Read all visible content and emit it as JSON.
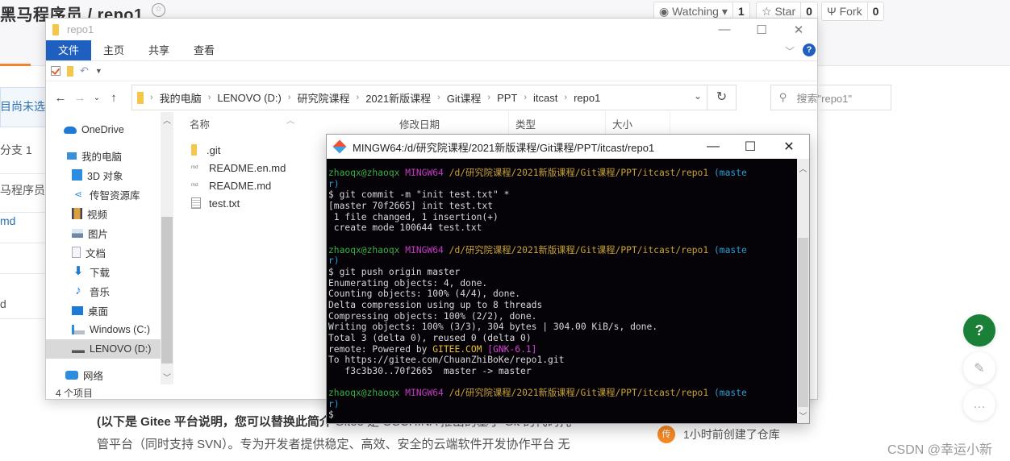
{
  "gitee": {
    "repo_title": "黑马程序员 / repo1",
    "watching": {
      "label": "Watching ▾",
      "count": "1"
    },
    "star": {
      "label": "☆ Star",
      "count": "0"
    },
    "fork": {
      "label": "Fork",
      "count": "0"
    },
    "left_strip": [
      "目尚未选择",
      "分支 1",
      "马程序员",
      "md",
      "",
      "d"
    ],
    "readme_line1_bold": "(以下是 Gitee 平台说明，您可以替换此简介",
    "readme_line1_rest": " Gitee 是 OSCHINA 推出的基于 Git 的代码托",
    "readme_line2": "管平台（同时支持 SVN）。专为开发者提供稳定、高效、安全的云端软件开发协作平台 无",
    "activity_avatar": "传",
    "activity_text": "1小时前创建了仓库",
    "help_button": "?",
    "watermark": "CSDN @幸运小新",
    "colors": {
      "accent_orange": "#f08530",
      "help_green": "#1a7f37"
    }
  },
  "explorer": {
    "title": "repo1",
    "ribbon_tabs": [
      "文件",
      "主页",
      "共享",
      "查看"
    ],
    "breadcrumbs": [
      "我的电脑",
      "LENOVO (D:)",
      "研究院课程",
      "2021新版课程",
      "Git课程",
      "PPT",
      "itcast",
      "repo1"
    ],
    "search_placeholder": "搜索\"repo1\"",
    "nav_items": [
      {
        "label": "OneDrive",
        "icon": "onedrive-icon"
      },
      {
        "label": "我的电脑",
        "icon": "computer-icon"
      },
      {
        "label": "3D 对象",
        "icon": "3d-objects-icon"
      },
      {
        "label": "传智资源库",
        "icon": "share-library-icon"
      },
      {
        "label": "视频",
        "icon": "video-icon"
      },
      {
        "label": "图片",
        "icon": "pictures-icon"
      },
      {
        "label": "文档",
        "icon": "documents-icon"
      },
      {
        "label": "下载",
        "icon": "download-icon"
      },
      {
        "label": "音乐",
        "icon": "music-icon"
      },
      {
        "label": "桌面",
        "icon": "desktop-icon"
      },
      {
        "label": "Windows (C:)",
        "icon": "drive-c-icon"
      },
      {
        "label": "LENOVO (D:)",
        "icon": "drive-d-icon",
        "selected": true
      },
      {
        "label": "网络",
        "icon": "network-icon"
      }
    ],
    "columns": [
      "名称",
      "修改日期",
      "类型",
      "大小"
    ],
    "files": [
      {
        "name": ".git",
        "icon": "folder-icon"
      },
      {
        "name": "README.en.md",
        "icon": "markdown-file-icon"
      },
      {
        "name": "README.md",
        "icon": "markdown-file-icon"
      },
      {
        "name": "test.txt",
        "icon": "text-file-icon"
      }
    ],
    "status": "4 个项目"
  },
  "terminal": {
    "title": "MINGW64:/d/研究院课程/2021新版课程/Git课程/PPT/itcast/repo1",
    "prompt": {
      "user": "zhaoqx@zhaoqx",
      "env": "MINGW64",
      "path": "/d/研究院课程/2021新版课程/Git课程/PPT/itcast/repo1",
      "branch_a": "(maste",
      "branch_b": "r)"
    },
    "block1": [
      "$ git commit -m \"init test.txt\" *",
      "[master 70f2665] init test.txt",
      " 1 file changed, 1 insertion(+)",
      " create mode 100644 test.txt"
    ],
    "block2": [
      "$ git push origin master",
      "Enumerating objects: 4, done.",
      "Counting objects: 100% (4/4), done.",
      "Delta compression using up to 8 threads",
      "Compressing objects: 100% (2/2), done.",
      "Writing objects: 100% (3/3), 304 bytes | 304.00 KiB/s, done.",
      "Total 3 (delta 0), reused 0 (delta 0)"
    ],
    "remote_prefix": "remote: Powered by ",
    "remote_gitee": "GITEE.COM",
    "remote_gnk": "[GNK-6.1]",
    "block3": [
      "To https://gitee.com/ChuanZhiBoKe/repo1.git",
      "   f3c3b30..70f2665  master -> master"
    ],
    "final_prompt": "$"
  }
}
